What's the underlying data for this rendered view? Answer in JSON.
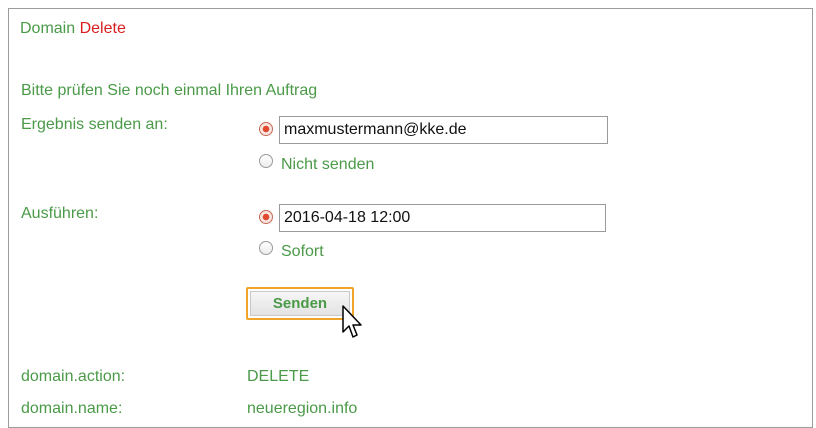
{
  "header": {
    "domain_label": "Domain",
    "action_label": "Delete"
  },
  "intro": "Bitte prüfen Sie noch einmal Ihren Auftrag",
  "result": {
    "label": "Ergebnis senden an:",
    "email_value": "maxmustermann@kke.de",
    "no_send_label": "Nicht senden",
    "selected": "email"
  },
  "execute": {
    "label": "Ausführen:",
    "datetime_value": "2016-04-18 12:00",
    "now_label": "Sofort",
    "selected": "datetime"
  },
  "submit_label": "Senden",
  "details": [
    {
      "key": "domain.action:",
      "value": "DELETE"
    },
    {
      "key": "domain.name:",
      "value": "neueregion.info"
    }
  ],
  "colors": {
    "text_green": "#4a9a48",
    "delete_red": "#d81f1f",
    "focus_orange": "#f0a42a"
  }
}
